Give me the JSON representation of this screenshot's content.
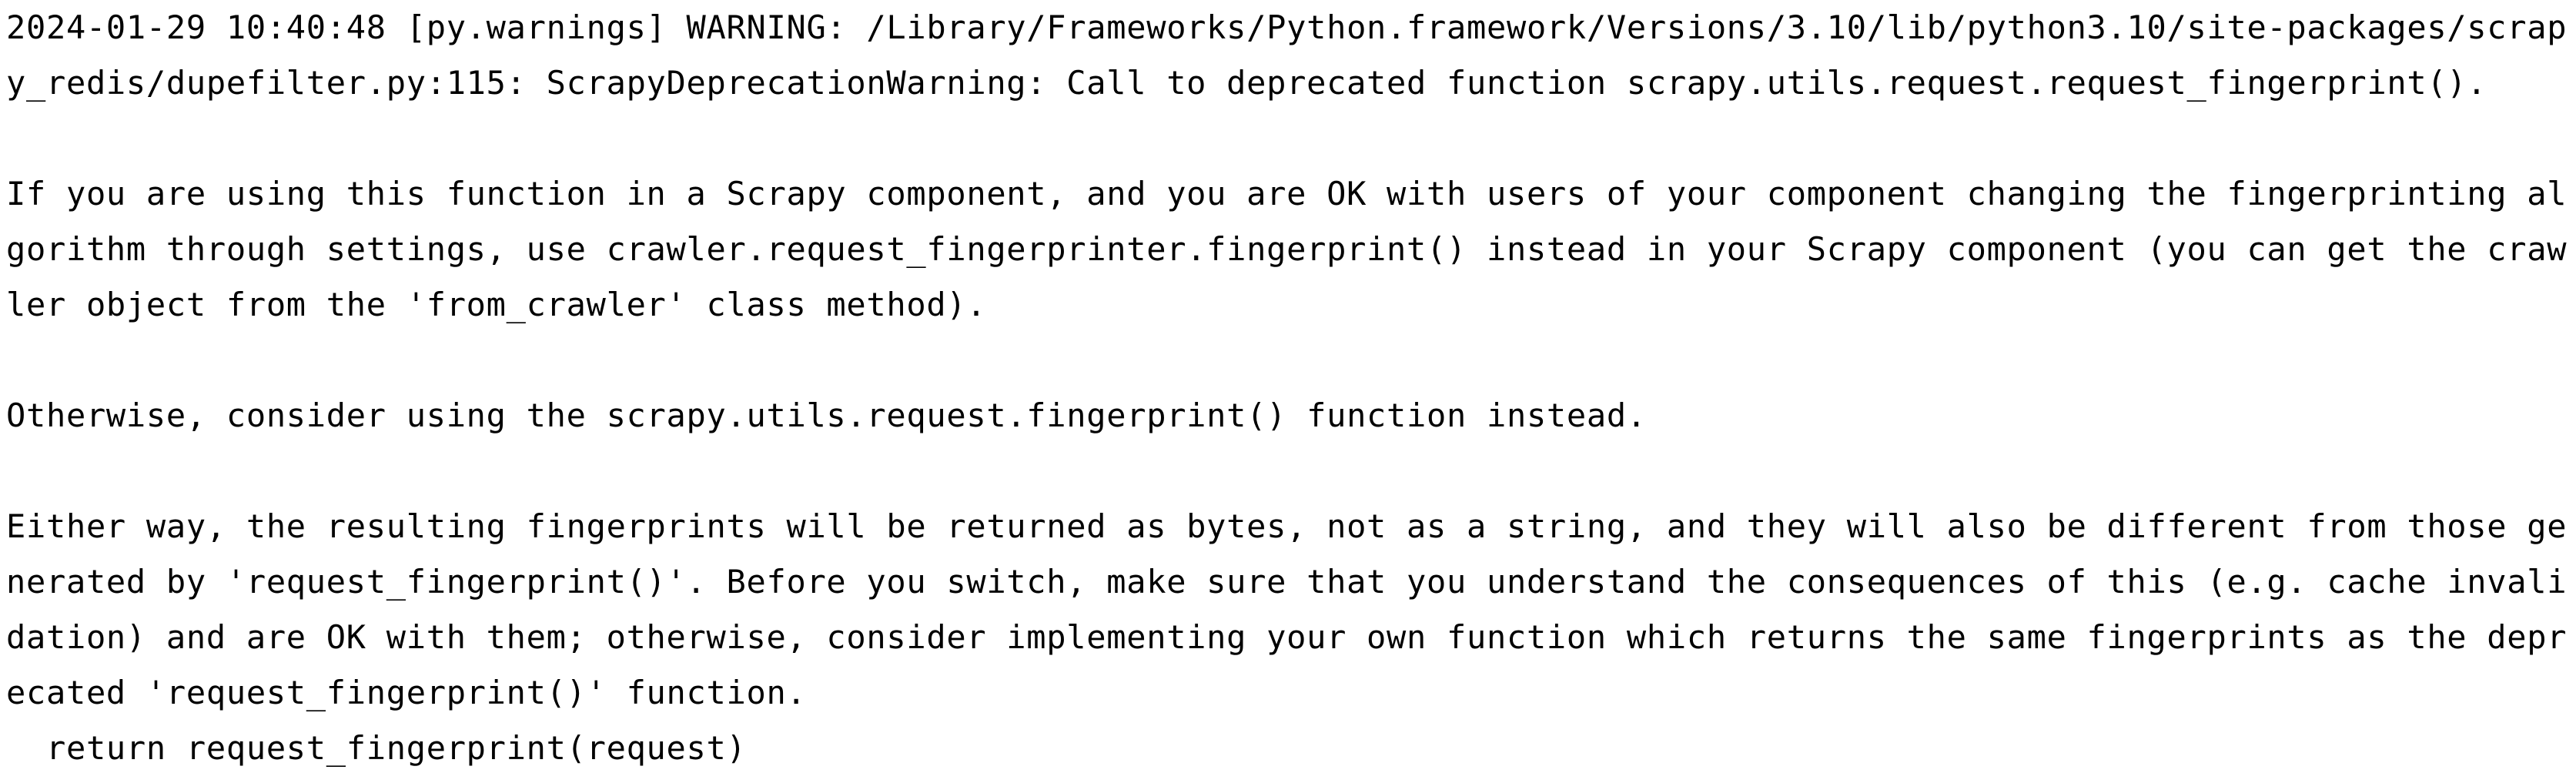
{
  "terminal": {
    "lines": [
      "2024-01-29 10:40:48 [py.warnings] WARNING: /Library/Frameworks/Python.framework/Versions/3.10/lib/python3.10/site-packages/scrap",
      "y_redis/dupefilter.py:115: ScrapyDeprecationWarning: Call to deprecated function scrapy.utils.request.request_fingerprint().",
      "",
      "If you are using this function in a Scrapy component, and you are OK with users of your component changing the fingerprinting al",
      "gorithm through settings, use crawler.request_fingerprinter.fingerprint() instead in your Scrapy component (you can get the craw",
      "ler object from the 'from_crawler' class method).",
      "",
      "Otherwise, consider using the scrapy.utils.request.fingerprint() function instead.",
      "",
      "Either way, the resulting fingerprints will be returned as bytes, not as a string, and they will also be different from those ge",
      "nerated by 'request_fingerprint()'. Before you switch, make sure that you understand the consequences of this (e.g. cache invali",
      "dation) and are OK with them; otherwise, consider implementing your own function which returns the same fingerprints as the depr",
      "ecated 'request_fingerprint()' function.",
      "  return request_fingerprint(request)"
    ]
  }
}
